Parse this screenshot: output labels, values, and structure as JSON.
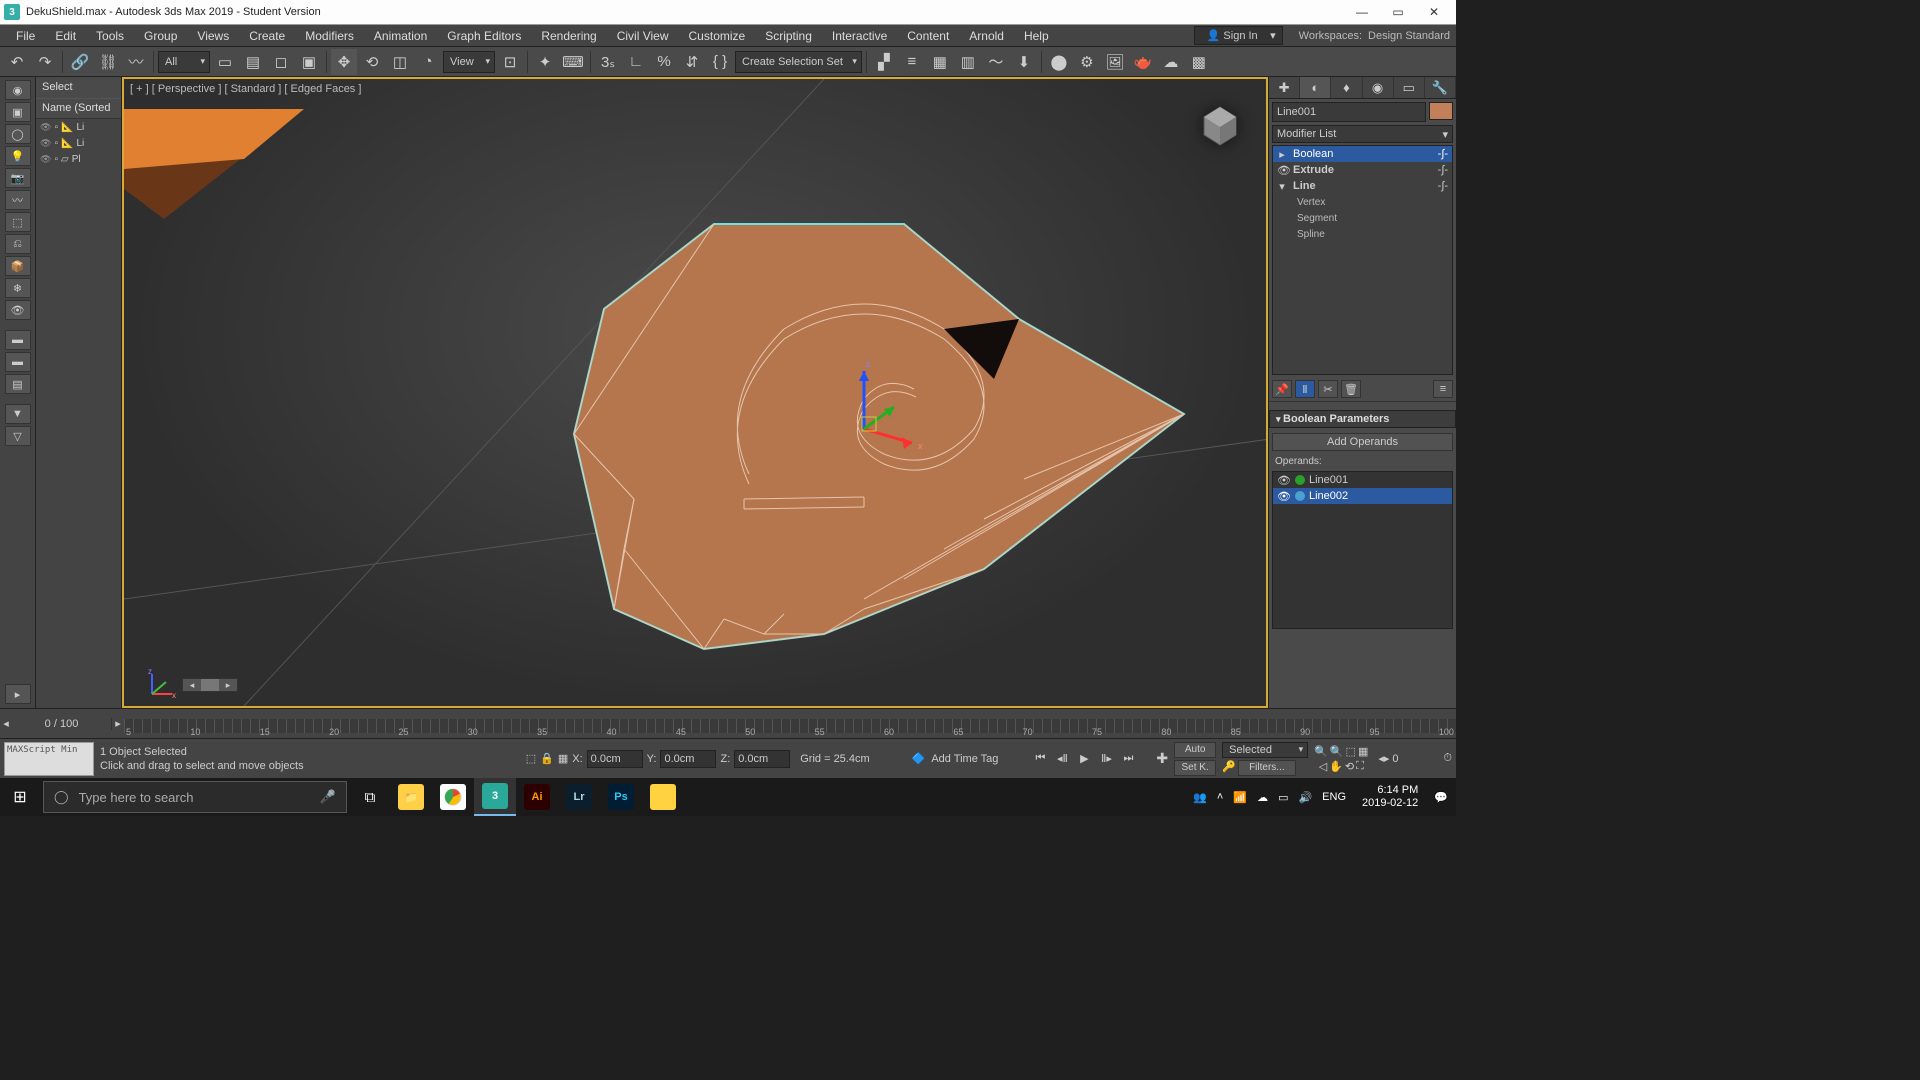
{
  "window": {
    "title": "DekuShield.max - Autodesk 3ds Max 2019 - Student Version"
  },
  "menus": [
    "File",
    "Edit",
    "Tools",
    "Group",
    "Views",
    "Create",
    "Modifiers",
    "Animation",
    "Graph Editors",
    "Rendering",
    "Civil View",
    "Customize",
    "Scripting",
    "Interactive",
    "Content",
    "Arnold",
    "Help"
  ],
  "signin": "Sign In",
  "workspace": {
    "label": "Workspaces:",
    "value": "Design Standard"
  },
  "toolbar": {
    "filter": "All",
    "view": "View",
    "selset": "Create Selection Set"
  },
  "scene": {
    "header": "Name (Sorted",
    "items": [
      "Li",
      "Li",
      "Pl"
    ],
    "select": "Select"
  },
  "viewport": {
    "label": "[ + ] [ Perspective ] [ Standard ] [ Edged Faces ]"
  },
  "cmd": {
    "object_name": "Line001",
    "modlist": "Modifier List",
    "stack": [
      {
        "label": "Boolean",
        "sel": true,
        "tog": "▸"
      },
      {
        "label": "Extrude",
        "sel": false,
        "tog": "👁",
        "bold": true
      },
      {
        "label": "Line",
        "sel": false,
        "tog": "▾"
      }
    ],
    "subs": [
      "Vertex",
      "Segment",
      "Spline"
    ],
    "roll": "Boolean Parameters",
    "addop": "Add Operands",
    "opslabel": "Operands:",
    "ops": [
      {
        "name": "Line001",
        "sel": false,
        "col": "#2aa02a"
      },
      {
        "name": "Line002",
        "sel": true,
        "col": "#4aa0d0"
      }
    ]
  },
  "time": {
    "counter": "0 / 100",
    "ticks": [
      "5",
      "10",
      "15",
      "20",
      "25",
      "30",
      "35",
      "40",
      "45",
      "50",
      "55",
      "60",
      "65",
      "70",
      "75",
      "80",
      "85",
      "90",
      "95",
      "100"
    ]
  },
  "status": {
    "mxs": "MAXScript Min",
    "line1": "1 Object Selected",
    "line2": "Click and drag to select and move objects",
    "x": "0.0cm",
    "y": "0.0cm",
    "z": "0.0cm",
    "grid": "Grid = 25.4cm",
    "addtag": "Add Time Tag",
    "auto": "Auto",
    "setk": "Set K.",
    "selected": "Selected",
    "filters": "Filters...",
    "frame": "0"
  },
  "taskbar": {
    "search": "Type here to search",
    "apps": [
      {
        "name": "explorer",
        "bg": "#ffcf48",
        "fg": "#7a5300",
        "txt": "📁"
      },
      {
        "name": "chrome",
        "bg": "#fff",
        "fg": "#333",
        "txt": "◉"
      },
      {
        "name": "3dsmax",
        "bg": "#2aa99a",
        "fg": "#fff",
        "txt": "3",
        "active": true
      },
      {
        "name": "illustrator",
        "bg": "#2d0000",
        "fg": "#ff9a00",
        "txt": "Ai"
      },
      {
        "name": "lightroom",
        "bg": "#0a1e2d",
        "fg": "#aed7e6",
        "txt": "Lr"
      },
      {
        "name": "photoshop",
        "bg": "#001d33",
        "fg": "#31c5f0",
        "txt": "Ps"
      },
      {
        "name": "notes",
        "bg": "#ffd23f",
        "fg": "#333",
        "txt": ""
      }
    ],
    "lang": "ENG",
    "time": "6:14 PM",
    "date": "2019-02-12"
  }
}
